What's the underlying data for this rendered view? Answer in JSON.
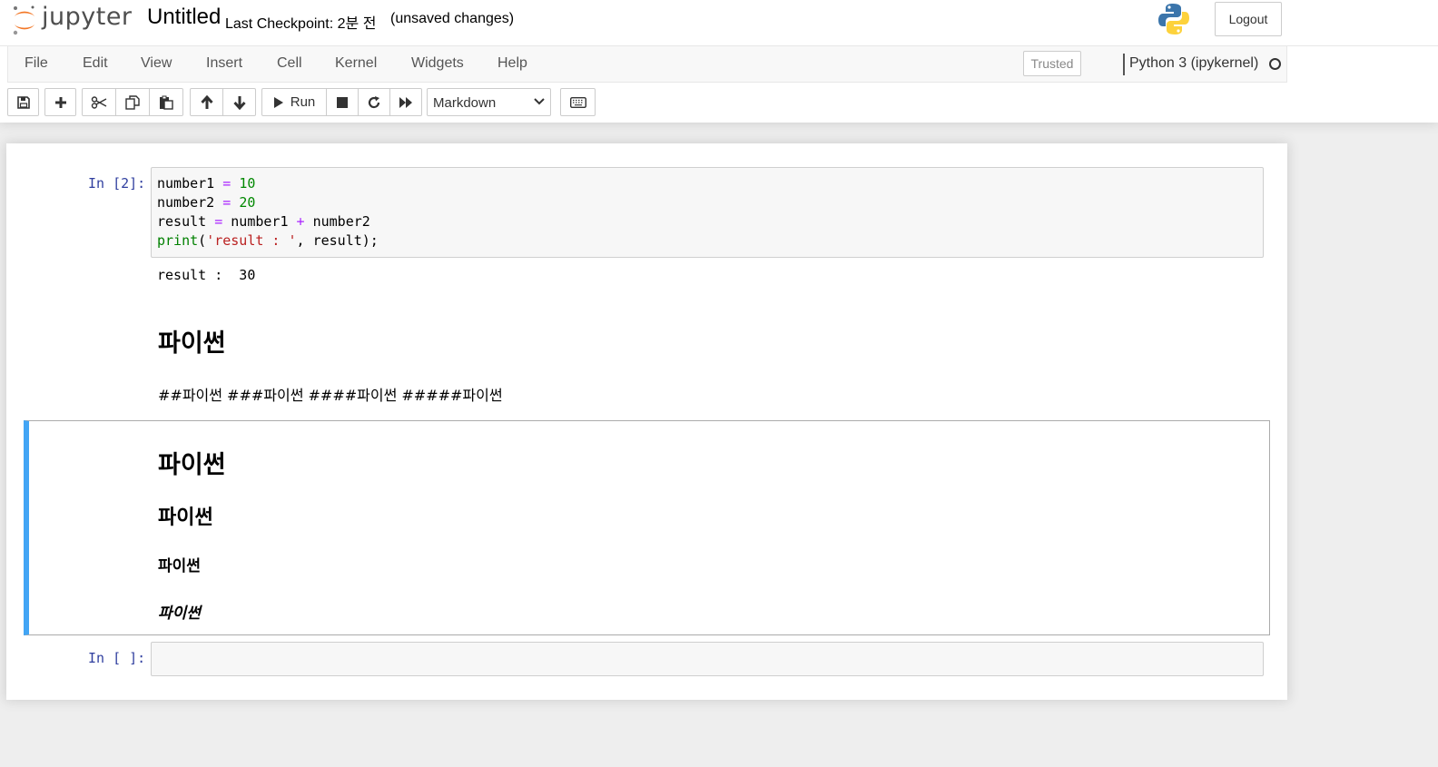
{
  "header": {
    "logo_text": "jupyter",
    "notebook_title": "Untitled",
    "checkpoint": "Last Checkpoint: 2분 전",
    "autosave_status": "(unsaved changes)",
    "logout_label": "Logout"
  },
  "menubar": {
    "items": [
      "File",
      "Edit",
      "View",
      "Insert",
      "Cell",
      "Kernel",
      "Widgets",
      "Help"
    ],
    "trusted_label": "Trusted",
    "kernel_name": "Python 3 (ipykernel)"
  },
  "toolbar": {
    "run_label": "Run",
    "cell_type": "Markdown"
  },
  "cells": {
    "code1": {
      "prompt": "In [2]:",
      "output": "result :  30"
    },
    "md1": {
      "heading": "파이썬",
      "paragraph": "##파이썬 ###파이썬 ####파이썬 #####파이썬"
    },
    "md2": {
      "h1": "파이썬",
      "h2": "파이썬",
      "h3": "파이썬",
      "h4": "파이썬"
    },
    "code2": {
      "prompt": "In [ ]:"
    }
  },
  "code_tokens": {
    "l1_var": "number1",
    "l1_op": "=",
    "l1_num": "10",
    "l2_var": "number2",
    "l2_op": "=",
    "l2_num": "20",
    "l3_var": "result",
    "l3_op": "=",
    "l3_a": "number1",
    "l3_plus": "+",
    "l3_b": "number2",
    "l4_fn": "print",
    "l4_open": "(",
    "l4_str": "'result : '",
    "l4_rest": ", result);"
  },
  "colors": {
    "accent": "#42a5f5",
    "prompt": "#303f9f",
    "jupyter_orange": "#f37726"
  }
}
